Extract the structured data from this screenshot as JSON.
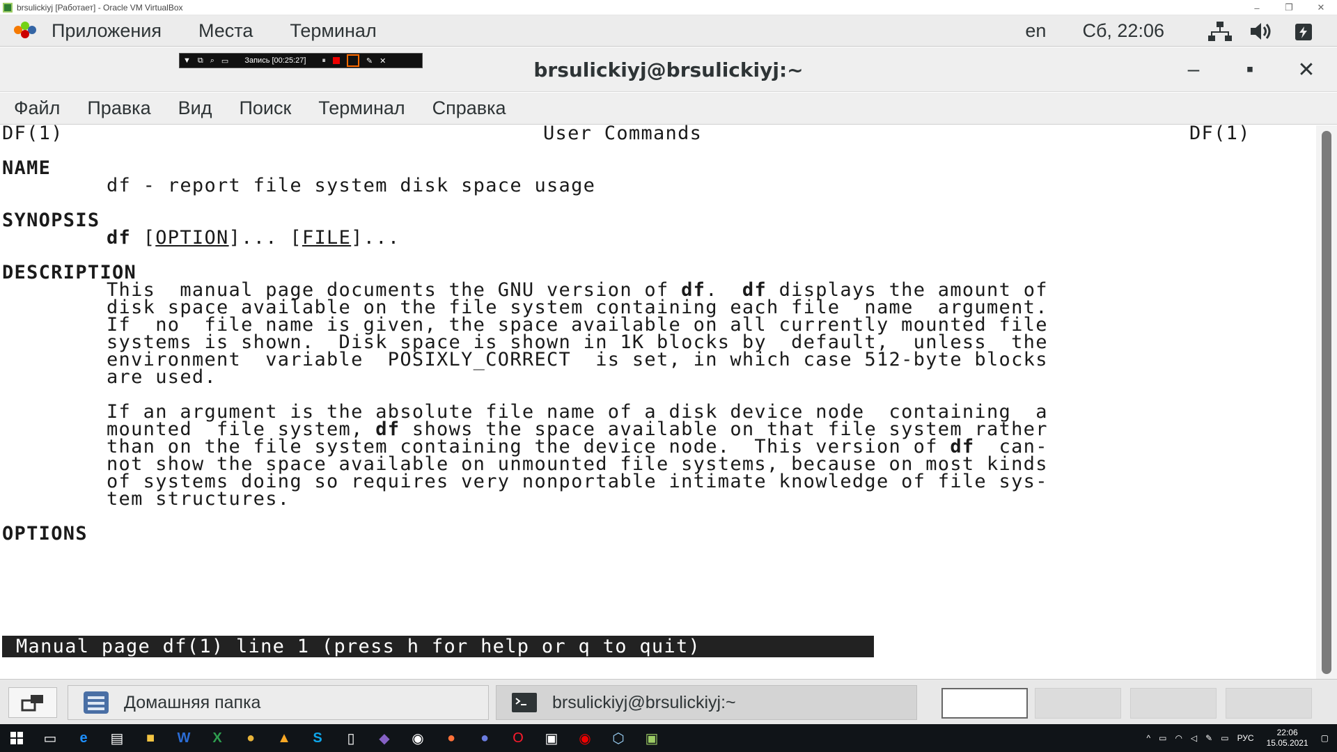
{
  "host": {
    "title": "brsulickiyj [Работает] - Oracle VM VirtualBox",
    "minimize": "–",
    "restore": "❐",
    "close": "✕"
  },
  "gnome_top": {
    "applications": "Приложения",
    "places": "Места",
    "terminal": "Терминал",
    "language": "en",
    "clock": "Сб, 22:06",
    "network_icon": "network-icon",
    "volume_icon": "volume-icon",
    "power_icon": "power-icon"
  },
  "recorder": {
    "label": "Запись [00:25:27]"
  },
  "window": {
    "title": "brsulickiyj@brsulickiyj:~",
    "minimize": "–",
    "maximize": "▪",
    "close": "✕"
  },
  "term_menu": [
    "Файл",
    "Правка",
    "Вид",
    "Поиск",
    "Терминал",
    "Справка"
  ],
  "man": {
    "header_left": "DF(1)",
    "header_center": "User Commands",
    "header_right": "DF(1)",
    "name_heading": "NAME",
    "name_text": "df - report file system disk space usage",
    "synopsis_heading": "SYNOPSIS",
    "syn_cmd": "df",
    "syn_open1": "[",
    "syn_option": "OPTION",
    "syn_mid": "]... [",
    "syn_file": "FILE",
    "syn_close": "]...",
    "desc_heading": "DESCRIPTION",
    "d1_a": "This  manual page documents the GNU version of ",
    "d1_b": "df",
    "d1_c": ".  ",
    "d1_d": "df",
    "d1_e": " displays the amount of",
    "d2": "disk space available on the file system containing each file  name  argument.",
    "d3": "If  no  file name is given, the space available on all currently mounted file",
    "d4": "systems is shown.  Disk space is shown in 1K blocks by  default,  unless  the",
    "d5": "environment  variable  POSIXLY_CORRECT  is set, in which case 512-byte blocks",
    "d6": "are used.",
    "p2_1": "If an argument is the absolute file name of a disk device node  containing  a",
    "p2_2a": "mounted  file system, ",
    "p2_2b": "df",
    "p2_2c": " shows the space available on that file system rather",
    "p2_3a": "than on the file system containing the device node.  This version of ",
    "p2_3b": "df",
    "p2_3c": "  can-",
    "p2_4": "not show the space available on unmounted file systems, because on most kinds",
    "p2_5": "of systems doing so requires very nonportable intimate knowledge of file sys-",
    "p2_6": "tem structures.",
    "options_heading": "OPTIONS",
    "status": "Manual page df(1) line 1 (press h for help or q to quit)"
  },
  "window_list": {
    "home_folder": "Домашняя папка",
    "terminal_task": "brsulickiyj@brsulickiyj:~"
  },
  "taskbar": {
    "lang": "РУС",
    "time": "22:06",
    "date": "15.05.2021"
  }
}
